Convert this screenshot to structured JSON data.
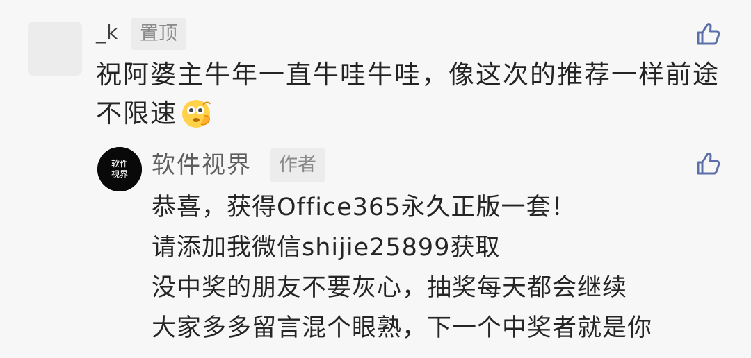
{
  "comment": {
    "username": "_k",
    "pin_label": "置顶",
    "text": "祝阿婆主牛年一直牛哇牛哇，像这次的推荐一样前途不限速",
    "emoji": "thinking-face",
    "like_icon": "thumbs-up-icon"
  },
  "reply": {
    "author": "软件视界",
    "author_badge": "作者",
    "avatar_text": "软件视界",
    "lines": [
      "恭喜，获得Office365永久正版一套！",
      "请添加我微信shijie25899获取",
      "没中奖的朋友不要灰心，抽奖每天都会继续",
      "大家多多留言混个眼熟，下一个中奖者就是你"
    ],
    "like_icon": "thumbs-up-icon"
  },
  "colors": {
    "background": "#f7f7f7",
    "text": "#242424",
    "muted": "#8a8a8a",
    "like": "#5c6fa8",
    "badge": "#ececec"
  }
}
